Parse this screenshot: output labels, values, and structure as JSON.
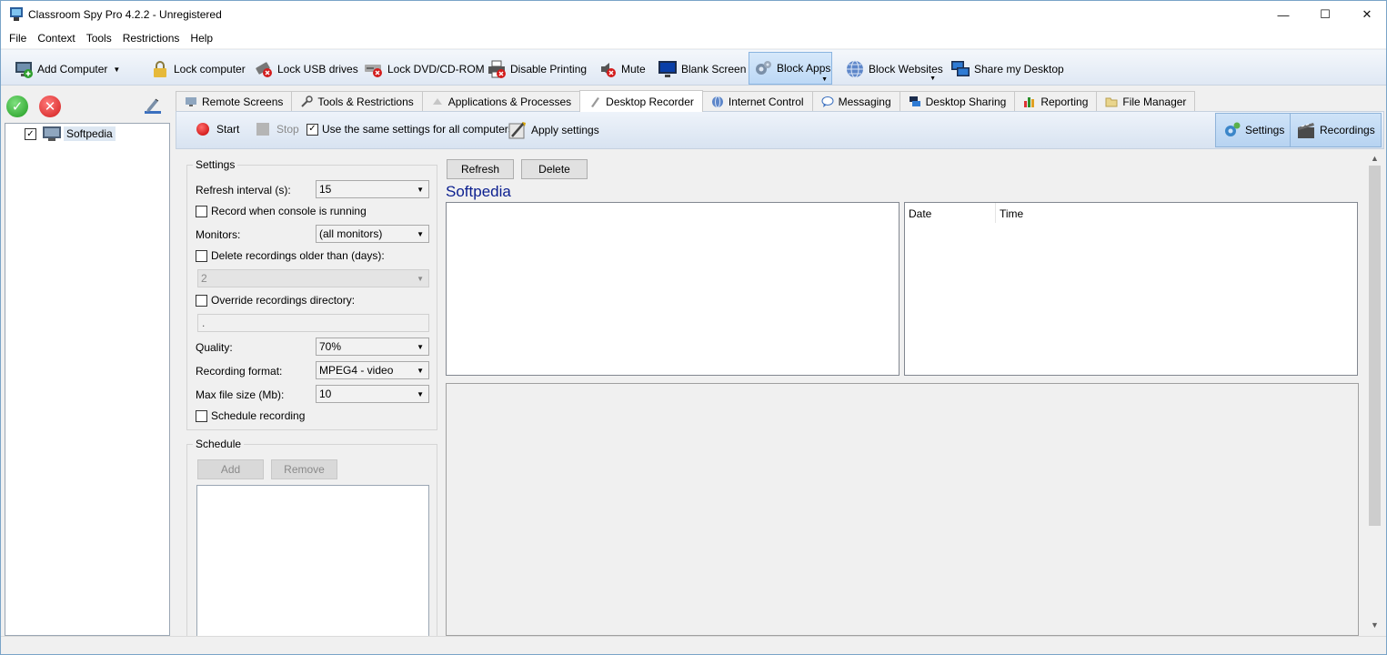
{
  "window": {
    "title": "Classroom Spy Pro 4.2.2 - Unregistered",
    "minimize": "—",
    "maximize": "☐",
    "close": "✕"
  },
  "menu": [
    "File",
    "Context",
    "Tools",
    "Restrictions",
    "Help"
  ],
  "toolbar": {
    "add_computer": "Add Computer",
    "lock_computer": "Lock computer",
    "lock_usb": "Lock USB drives",
    "lock_dvd": "Lock DVD/CD-ROM",
    "disable_printing": "Disable Printing",
    "mute": "Mute",
    "blank_screen": "Blank Screen",
    "block_apps": "Block Apps",
    "block_websites": "Block Websites",
    "share_desktop": "Share my Desktop"
  },
  "tree": {
    "computer": "Softpedia",
    "checked": "✓"
  },
  "tabs": [
    "Remote Screens",
    "Tools & Restrictions",
    "Applications & Processes",
    "Desktop Recorder",
    "Internet Control",
    "Messaging",
    "Desktop Sharing",
    "Reporting",
    "File Manager"
  ],
  "subtoolbar": {
    "start": "Start",
    "stop": "Stop",
    "same_settings": "Use the same settings for all computers",
    "same_settings_checked": "✓",
    "apply": "Apply settings",
    "settings": "Settings",
    "recordings": "Recordings"
  },
  "settings": {
    "group_title": "Settings",
    "refresh_label": "Refresh interval (s):",
    "refresh_value": "15",
    "record_console": "Record when console is running",
    "monitors_label": "Monitors:",
    "monitors_value": "(all monitors)",
    "delete_older": "Delete recordings older than (days):",
    "delete_days": "2",
    "override_dir": "Override recordings directory:",
    "dir_value": ".",
    "quality_label": "Quality:",
    "quality_value": "70%",
    "format_label": "Recording format:",
    "format_value": "MPEG4 - video",
    "maxsize_label": "Max file size (Mb):",
    "maxsize_value": "10",
    "schedule_recording": "Schedule recording"
  },
  "schedule": {
    "group_title": "Schedule",
    "add": "Add",
    "remove": "Remove"
  },
  "recorder": {
    "refresh": "Refresh",
    "delete": "Delete",
    "computer_name": "Softpedia",
    "col_date": "Date",
    "col_time": "Time"
  },
  "colors": {
    "accent": "#0b1f8f",
    "toolbar_active": "#bcd8f6"
  }
}
